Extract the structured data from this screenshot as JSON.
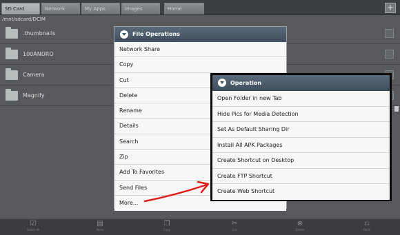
{
  "tabs": [
    "SD Card",
    "Network",
    "My Apps",
    "Images",
    "Home"
  ],
  "current_path": "/mnt/sdcard/DCIM",
  "files": [
    ".thumbnails",
    "100ANDRO",
    "Camera",
    "Magnify"
  ],
  "toolbar": {
    "items": [
      "Select All",
      "Paste",
      "Copy",
      "Cut",
      "Delete",
      "Back"
    ],
    "icons": [
      "select-all-icon",
      "paste-icon",
      "copy-icon",
      "cut-icon",
      "delete-icon",
      "back-icon"
    ]
  },
  "file_operations": {
    "title": "File Operations",
    "items": [
      "Network Share",
      "Copy",
      "Cut",
      "Delete",
      "Rename",
      "Details",
      "Search",
      "Zip",
      "Add To Favorites",
      "Send Files",
      "More..."
    ]
  },
  "operation": {
    "title": "Operation",
    "items": [
      "Open Folder in new Tab",
      "Hide Pics for Media Detection",
      "Set As Default Sharing Dir",
      "Install All APK Packages",
      "Create Shortcut on Desktop",
      "Create FTP Shortcut",
      "Create Web Shortcut"
    ]
  },
  "colors": {
    "annotation_arrow": "#e11b1b",
    "dialog_title_bar": "#4a5866",
    "highlight_border": "#0a0a0a"
  }
}
